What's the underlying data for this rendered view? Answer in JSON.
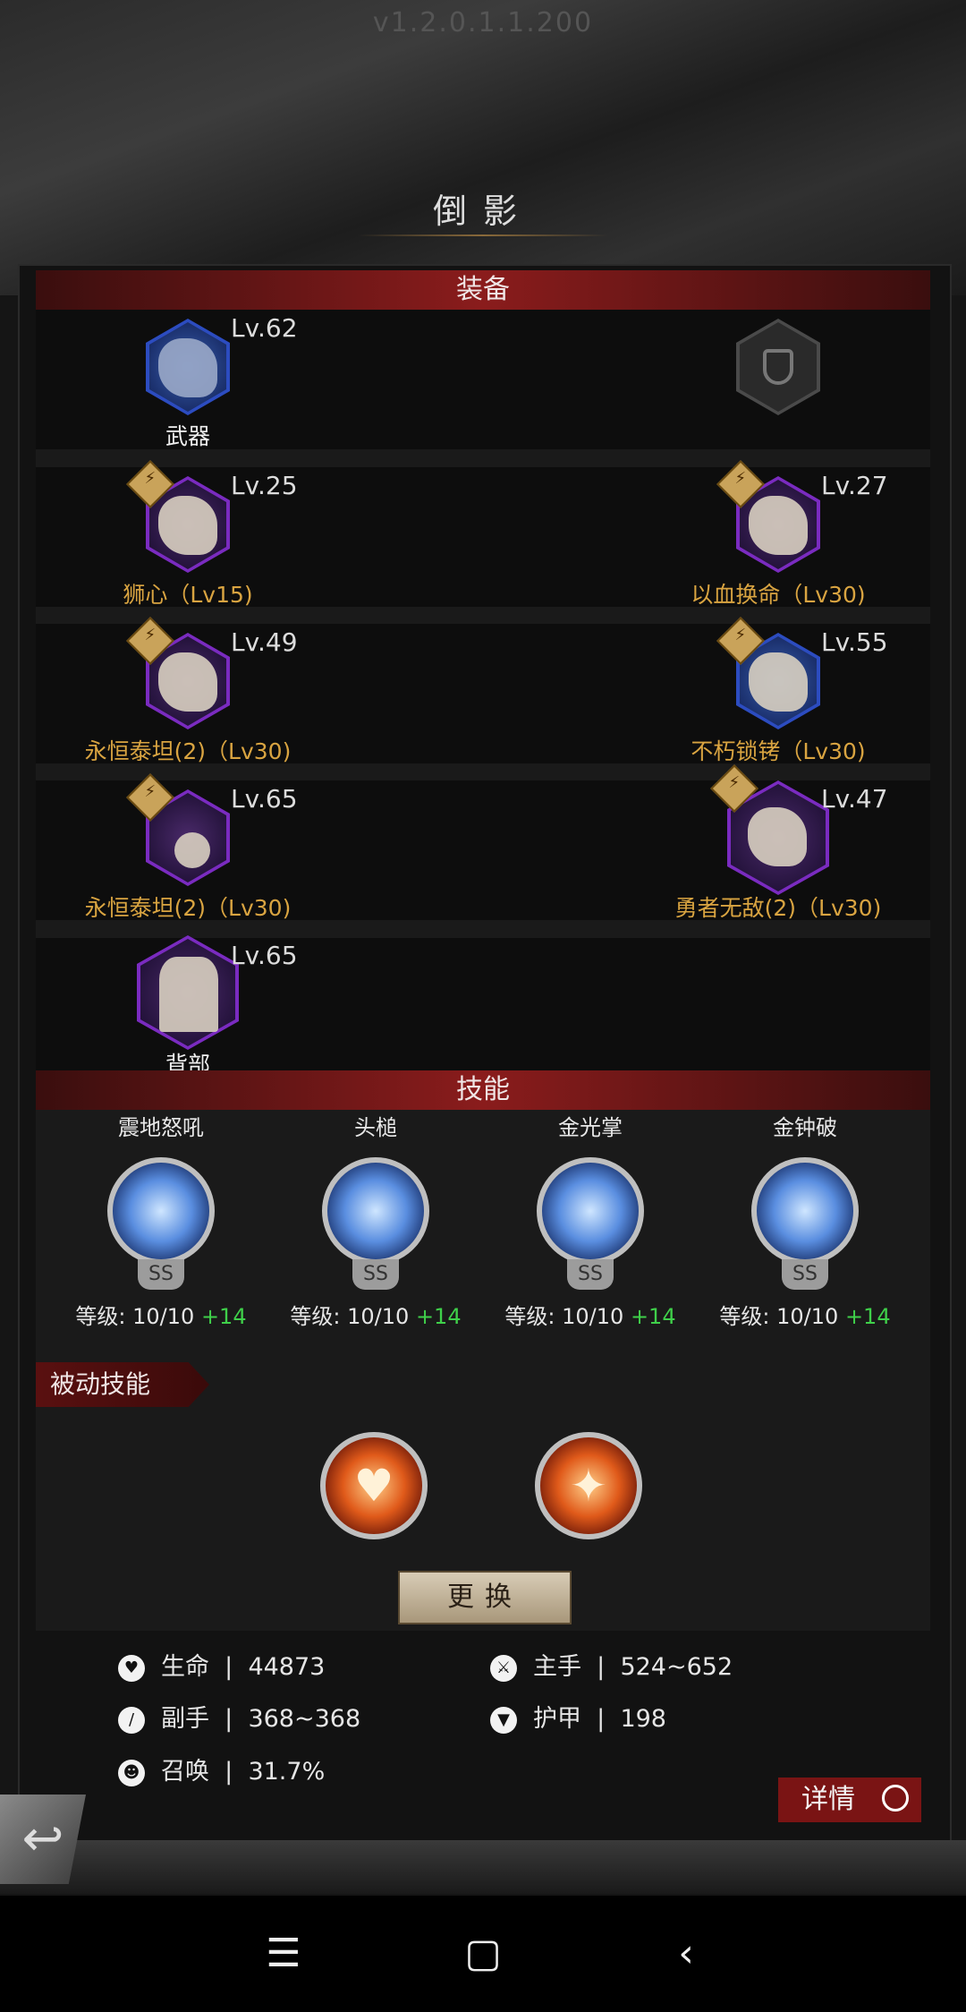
{
  "version": "v1.2.0.1.1.200",
  "title": "倒影",
  "equipment_header": "装备",
  "equipment": [
    {
      "level": "Lv.62",
      "label": "武器",
      "label_color": "white",
      "frame": "blue",
      "badge": false
    },
    {
      "level": "",
      "label": "",
      "frame": "empty",
      "badge": false,
      "icon": "shield-icon"
    },
    {
      "level": "Lv.25",
      "label": "狮心（Lv15)",
      "frame": "purple",
      "badge": true
    },
    {
      "level": "Lv.27",
      "label": "以血换命（Lv30)",
      "frame": "purple",
      "badge": true
    },
    {
      "level": "Lv.49",
      "label": "永恒泰坦(2)（Lv30)",
      "frame": "purple",
      "badge": true
    },
    {
      "level": "Lv.55",
      "label": "不朽锁铐（Lv30)",
      "frame": "blue",
      "badge": true
    },
    {
      "level": "Lv.65",
      "label": "永恒泰坦(2)（Lv30)",
      "frame": "purple",
      "badge": true
    },
    {
      "level": "Lv.47",
      "label": "勇者无敌(2)（Lv30)",
      "frame": "purple",
      "badge": true
    },
    {
      "level": "Lv.65",
      "label": "背部",
      "label_color": "white",
      "frame": "purple",
      "badge": false
    }
  ],
  "skills_header": "技能",
  "skills": [
    {
      "name": "震地怒吼",
      "grade": "SS",
      "level_text": "等级: 10/10",
      "bonus": "+14"
    },
    {
      "name": "头槌",
      "grade": "SS",
      "level_text": "等级: 10/10",
      "bonus": "+14"
    },
    {
      "name": "金光掌",
      "grade": "SS",
      "level_text": "等级: 10/10",
      "bonus": "+14"
    },
    {
      "name": "金钟破",
      "grade": "SS",
      "level_text": "等级: 10/10",
      "bonus": "+14"
    }
  ],
  "passive_header": "被动技能",
  "passives": [
    {
      "icon": "heart-hands-icon",
      "glyph": "♥"
    },
    {
      "icon": "figure-shield-icon",
      "glyph": "✦"
    }
  ],
  "change_button": "更换",
  "stats": {
    "hp": {
      "label": "生命",
      "sep": "|",
      "value": "44873",
      "icon": "heart-icon"
    },
    "main_hand": {
      "label": "主手",
      "sep": "|",
      "value": "524~652",
      "icon": "sword-icon"
    },
    "off_hand": {
      "label": "副手",
      "sep": "|",
      "value": "368~368",
      "icon": "dagger-icon"
    },
    "armor": {
      "label": "护甲",
      "sep": "|",
      "value": "198",
      "icon": "armor-icon"
    },
    "summon": {
      "label": "召唤",
      "sep": "|",
      "value": "31.7%",
      "icon": "summon-icon"
    }
  },
  "detail_button": "详情",
  "nav": {
    "menu": "☰",
    "home": "▢",
    "back": "‹"
  }
}
